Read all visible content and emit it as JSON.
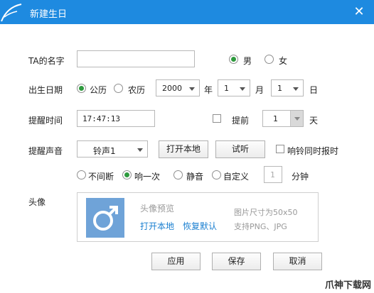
{
  "window": {
    "title": "新建生日",
    "close_glyph": "✕"
  },
  "name_field": {
    "label": "TA的名字",
    "value": ""
  },
  "gender": {
    "male": "男",
    "female": "女",
    "selected": "male"
  },
  "birth": {
    "label": "出生日期",
    "calendar_solar": "公历",
    "calendar_lunar": "农历",
    "selected_calendar": "solar",
    "year": "2000",
    "year_unit": "年",
    "month": "1",
    "month_unit": "月",
    "day": "1",
    "day_unit": "日"
  },
  "reminder_time": {
    "label": "提醒时间",
    "value": "17:47:13",
    "advance_label": "提前",
    "advance_checked": false,
    "advance_days": "1",
    "advance_unit": "天"
  },
  "sound": {
    "label": "提醒声音",
    "ringtone": "铃声1",
    "open_local": "打开本地",
    "listen": "试听",
    "announce_label": "响铃同时报时",
    "announce_checked": false,
    "modes": [
      "不间断",
      "响一次",
      "静音",
      "自定义"
    ],
    "selected_mode": 1,
    "custom_minutes": "1",
    "minutes_unit": "分钟"
  },
  "avatar": {
    "label": "头像",
    "preview_label": "头像预览",
    "open_local": "打开本地",
    "restore_default": "恢复默认",
    "size_note": "图片尺寸为50x50",
    "format_note": "支持PNG、JPG",
    "icon": "male-symbol-icon"
  },
  "buttons": {
    "apply": "应用",
    "save": "保存",
    "cancel": "取消"
  },
  "watermark": "爪神下载网",
  "colors": {
    "titlebar": "#1e8ae0",
    "radio_selected": "#2e9a3e",
    "link": "#1a7fd0",
    "avatar_bg": "#6fa3d8"
  }
}
